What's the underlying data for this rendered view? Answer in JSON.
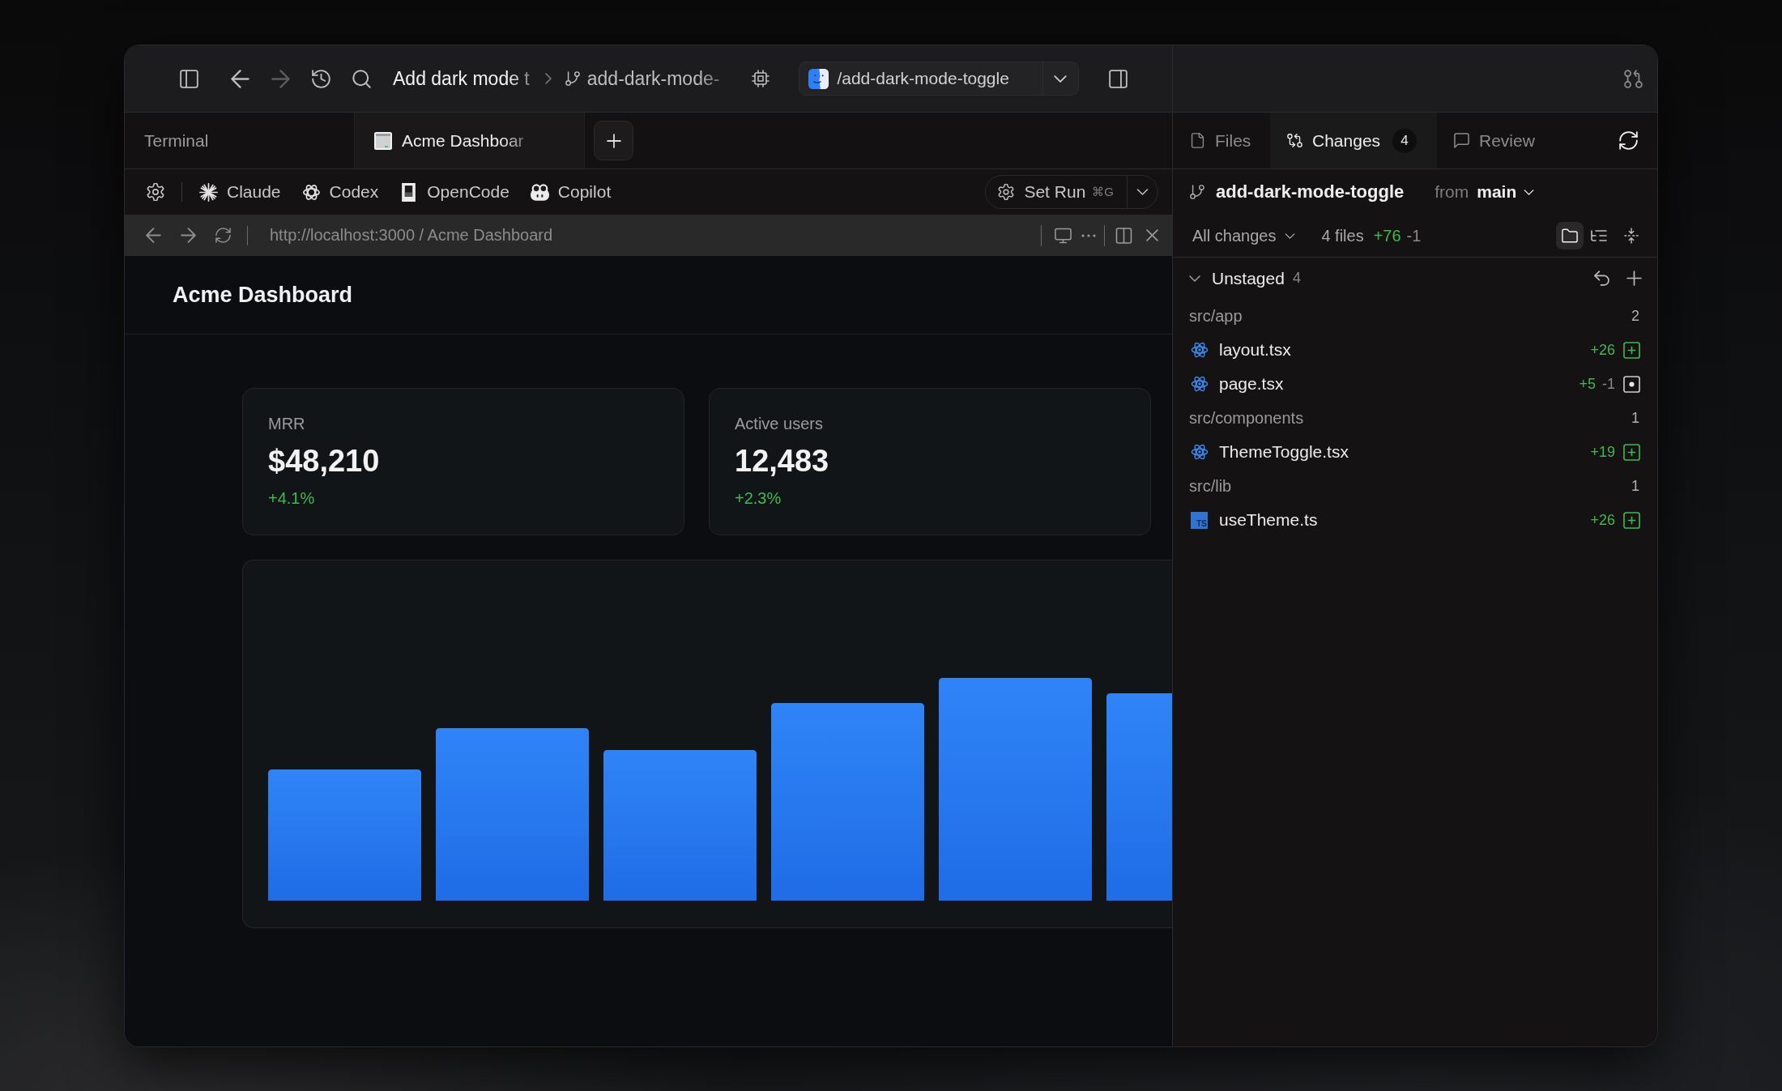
{
  "title_bar": {
    "task_title": "Add dark mode t",
    "branch_crumb": "add-dark-mode-",
    "forward_button": {
      "disabled": true
    },
    "worktree": "/add-dark-mode-toggle"
  },
  "tabs": [
    {
      "label": "Terminal",
      "kind": "terminal",
      "selected": false
    },
    {
      "label": "Acme Dashboar",
      "kind": "browser",
      "selected": true
    }
  ],
  "agents": [
    {
      "label": "Claude",
      "kind": "claude"
    },
    {
      "label": "Codex",
      "kind": "codex"
    },
    {
      "label": "OpenCode",
      "kind": "opencode"
    },
    {
      "label": "Copilot",
      "kind": "copilot"
    }
  ],
  "run_button": {
    "label": "Set Run",
    "shortcut": "⌘G"
  },
  "address_bar": {
    "url": "http://localhost:3000 / Acme Dashboard"
  },
  "page": {
    "title": "Acme Dashboard",
    "stats": [
      {
        "label": "MRR",
        "value": "$48,210",
        "change": "+4.1%"
      },
      {
        "label": "Active users",
        "value": "12,483",
        "change": "+2.3%"
      }
    ]
  },
  "changes_panel": {
    "tabs": [
      {
        "label": "Files",
        "kind": "files",
        "selected": false
      },
      {
        "label": "Changes",
        "kind": "changes",
        "count": "4",
        "selected": true
      },
      {
        "label": "Review",
        "kind": "review",
        "selected": false
      }
    ],
    "branch": "add-dark-mode-toggle",
    "from_label": "from",
    "base_branch": "main",
    "filter": "All changes",
    "file_count": "4 files",
    "additions": "+76",
    "deletions": "-1",
    "view_modes": [
      {
        "kind": "folders",
        "selected": true
      },
      {
        "kind": "tree",
        "selected": false
      }
    ],
    "section": {
      "title": "Unstaged",
      "count": "4",
      "expanded": true,
      "groups": [
        {
          "path": "src/app",
          "count": "2",
          "files": [
            {
              "name": "layout.tsx",
              "kind": "react",
              "additions": "+26",
              "new_file": true
            },
            {
              "name": "page.tsx",
              "kind": "react",
              "additions": "+5",
              "deletions": "-1",
              "new_file": false
            }
          ]
        },
        {
          "path": "src/components",
          "count": "1",
          "files": [
            {
              "name": "ThemeToggle.tsx",
              "kind": "react",
              "additions": "+19",
              "new_file": true
            }
          ]
        },
        {
          "path": "src/lib",
          "count": "1",
          "files": [
            {
              "name": "useTheme.ts",
              "kind": "typescript",
              "icon_label": "TS",
              "additions": "+26",
              "new_file": true
            }
          ]
        }
      ]
    }
  }
}
